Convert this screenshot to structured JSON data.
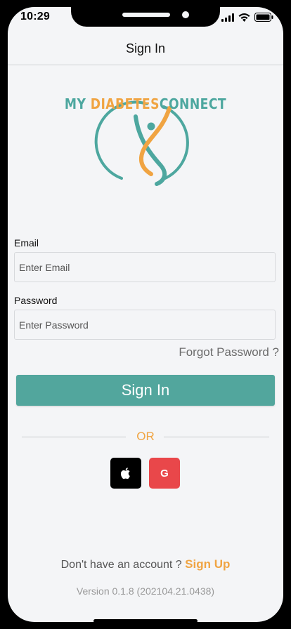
{
  "status_bar": {
    "time": "10:29"
  },
  "header": {
    "title": "Sign In"
  },
  "logo": {
    "word_my": "MY ",
    "word_diabetes": "DIABETES",
    "word_connect": "CONNECT"
  },
  "form": {
    "email_label": "Email",
    "email_placeholder": "Enter Email",
    "password_label": "Password",
    "password_placeholder": "Enter Password",
    "forgot_label": "Forgot Password ?",
    "signin_label": "Sign In"
  },
  "divider": {
    "or_label": "OR"
  },
  "social": {
    "google_glyph": "G"
  },
  "footer": {
    "account_prompt": "Don't have an account ? ",
    "signup_label": "Sign Up",
    "version": "Version 0.1.8 (202104.21.0438)"
  },
  "colors": {
    "teal": "#52a69d",
    "orange": "#f0a442",
    "google_red": "#e9474a"
  }
}
